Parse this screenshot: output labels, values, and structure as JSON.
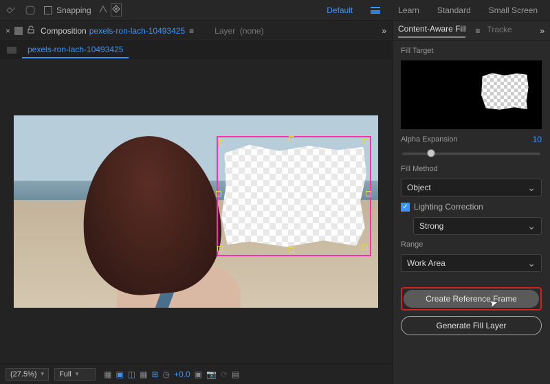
{
  "toolbar": {
    "snapping_label": "Snapping"
  },
  "workspaces": {
    "default": "Default",
    "learn": "Learn",
    "standard": "Standard",
    "small_screen": "Small Screen"
  },
  "composition_panel": {
    "title": "Composition",
    "link": "pexels-ron-lach-10493425",
    "layer_label": "Layer",
    "layer_value": "(none)"
  },
  "tabs": {
    "active": "pexels-ron-lach-10493425"
  },
  "footer": {
    "zoom": "(27.5%)",
    "resolution": "Full",
    "exposure": "+0.0"
  },
  "right_panel": {
    "tab_caf": "Content-Aware Fill",
    "tab_tracker": "Tracke",
    "fill_target_label": "Fill Target",
    "alpha_expansion_label": "Alpha Expansion",
    "alpha_expansion_value": "10",
    "fill_method_label": "Fill Method",
    "fill_method_value": "Object",
    "lighting_correction_label": "Lighting Correction",
    "lighting_strength_value": "Strong",
    "range_label": "Range",
    "range_value": "Work Area",
    "create_ref_button": "Create Reference Frame",
    "generate_fill_button": "Generate Fill Layer"
  }
}
